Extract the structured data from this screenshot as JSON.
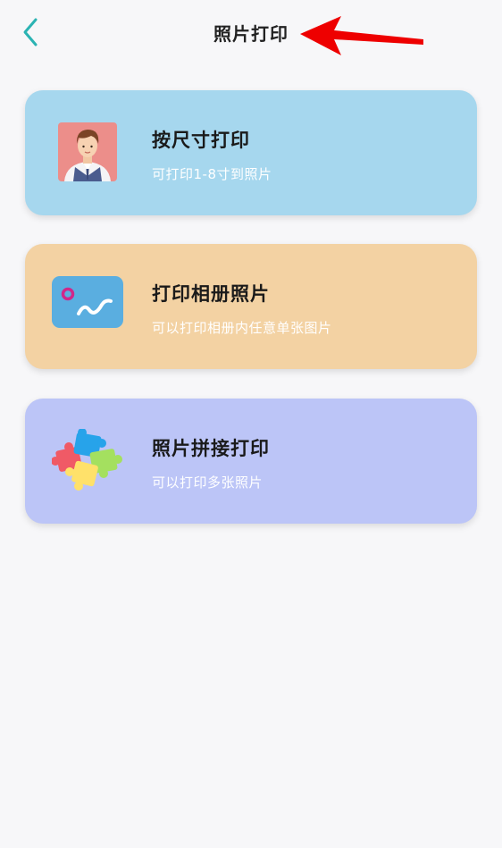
{
  "header": {
    "title": "照片打印",
    "back_icon": "back-chevron-icon"
  },
  "colors": {
    "accent": "#2bb3b3",
    "arrow": "#ee0000",
    "card_size": "#a6d7ee",
    "card_album": "#f3d2a3",
    "card_collage": "#bcc5f7"
  },
  "cards": [
    {
      "title": "按尺寸打印",
      "subtitle": "可打印1-8寸到照片",
      "icon": "portrait-icon"
    },
    {
      "title": "打印相册照片",
      "subtitle": "可以打印相册内任意单张图片",
      "icon": "photo-album-icon"
    },
    {
      "title": "照片拼接打印",
      "subtitle": "可以打印多张照片",
      "icon": "puzzle-icon"
    }
  ]
}
